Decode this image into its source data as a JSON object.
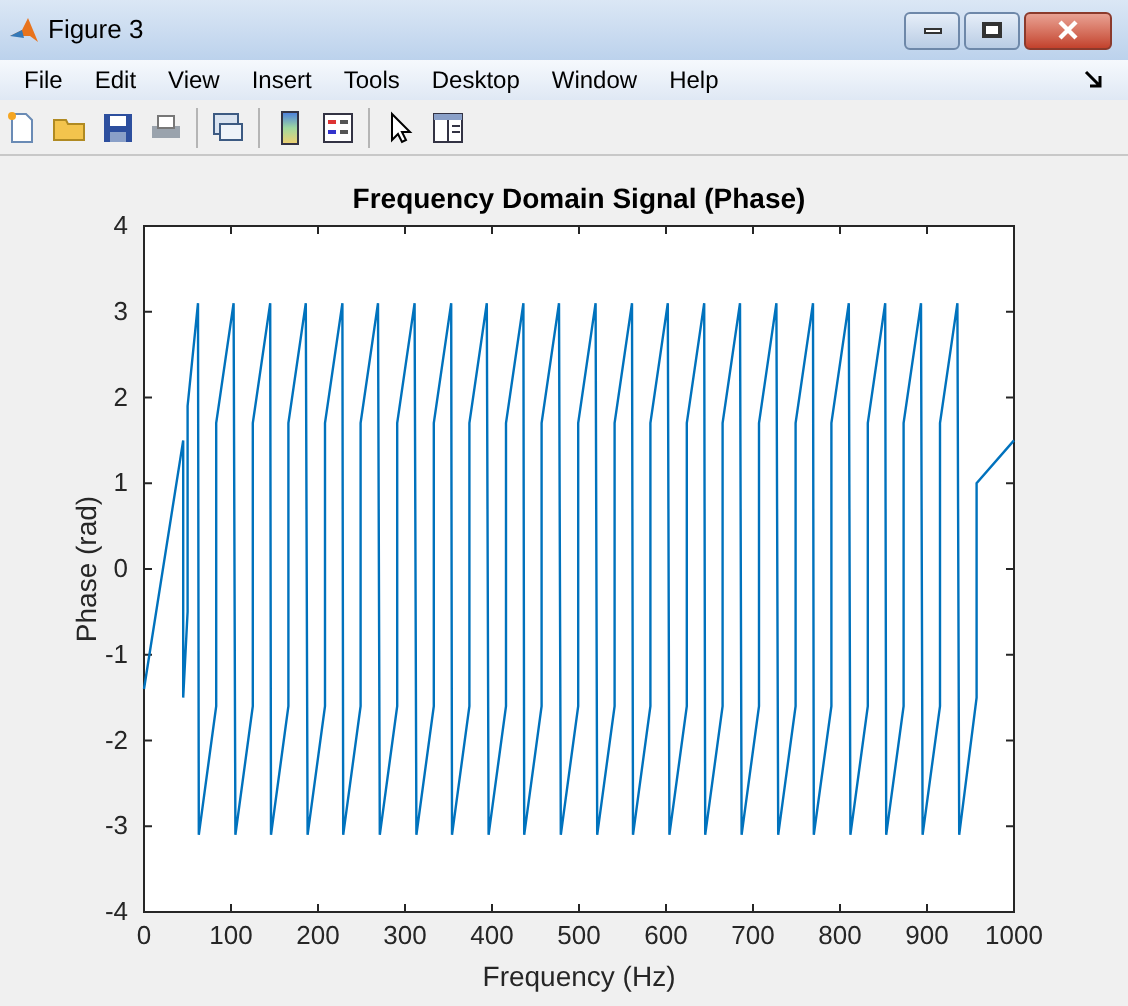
{
  "window": {
    "title": "Figure 3"
  },
  "menu": [
    "File",
    "Edit",
    "View",
    "Insert",
    "Tools",
    "Desktop",
    "Window",
    "Help"
  ],
  "chart_data": {
    "type": "line",
    "title": "Frequency Domain Signal (Phase)",
    "xlabel": "Frequency (Hz)",
    "ylabel": "Phase (rad)",
    "xlim": [
      0,
      1000
    ],
    "ylim": [
      -4,
      4
    ],
    "xticks": [
      0,
      100,
      200,
      300,
      400,
      500,
      600,
      700,
      800,
      900,
      1000
    ],
    "yticks": [
      -4,
      -3,
      -2,
      -1,
      0,
      1,
      2,
      3,
      4
    ],
    "x": [
      0,
      45,
      45,
      50,
      50,
      62,
      63,
      83,
      83,
      103,
      105,
      125,
      125,
      145,
      146,
      166,
      166,
      186,
      188,
      208,
      208,
      228,
      229,
      249,
      249,
      269,
      271,
      291,
      291,
      311,
      313,
      333,
      333,
      353,
      354,
      374,
      374,
      394,
      396,
      416,
      416,
      436,
      437,
      457,
      457,
      477,
      479,
      499,
      499,
      519,
      521,
      541,
      541,
      561,
      562,
      582,
      582,
      602,
      604,
      624,
      624,
      644,
      645,
      665,
      665,
      685,
      687,
      707,
      707,
      727,
      729,
      749,
      749,
      769,
      770,
      790,
      790,
      810,
      812,
      832,
      832,
      852,
      853,
      873,
      873,
      893,
      895,
      915,
      915,
      935,
      937,
      957,
      957,
      1000
    ],
    "series": [
      {
        "color": "#0072bd",
        "values": [
          -1.4,
          1.5,
          -1.5,
          -0.5,
          1.9,
          3.1,
          -3.1,
          -1.6,
          1.7,
          3.1,
          -3.1,
          -1.6,
          1.7,
          3.1,
          -3.1,
          -1.6,
          1.7,
          3.1,
          -3.1,
          -1.6,
          1.7,
          3.1,
          -3.1,
          -1.6,
          1.7,
          3.1,
          -3.1,
          -1.6,
          1.7,
          3.1,
          -3.1,
          -1.6,
          1.7,
          3.1,
          -3.1,
          -1.6,
          1.7,
          3.1,
          -3.1,
          -1.6,
          1.7,
          3.1,
          -3.1,
          -1.6,
          1.7,
          3.1,
          -3.1,
          -1.6,
          1.7,
          3.1,
          -3.1,
          -1.6,
          1.7,
          3.1,
          -3.1,
          -1.6,
          1.7,
          3.1,
          -3.1,
          -1.6,
          1.7,
          3.1,
          -3.1,
          -1.6,
          1.7,
          3.1,
          -3.1,
          -1.6,
          1.7,
          3.1,
          -3.1,
          -1.6,
          1.7,
          3.1,
          -3.1,
          -1.6,
          1.7,
          3.1,
          -3.1,
          -1.6,
          1.7,
          3.1,
          -3.1,
          -1.6,
          1.7,
          3.1,
          -3.1,
          -1.6,
          1.7,
          3.1,
          -3.1,
          -1.5,
          1.0,
          1.5
        ]
      }
    ]
  }
}
